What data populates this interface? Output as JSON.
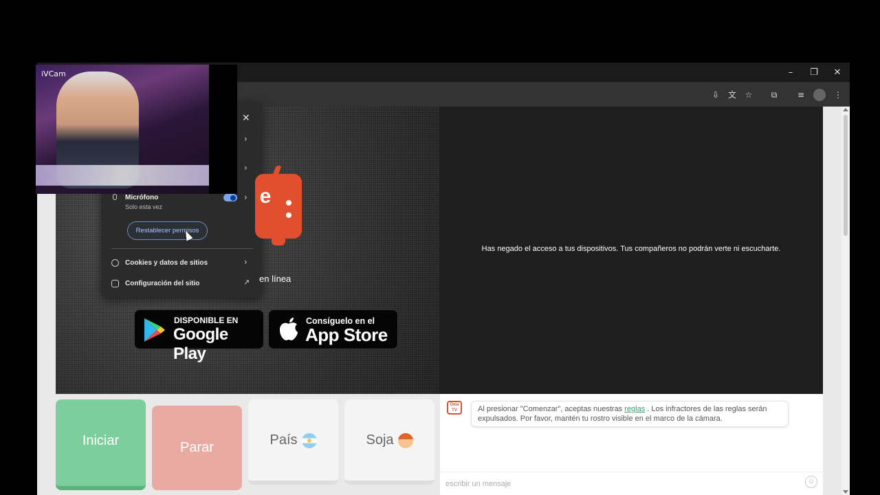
{
  "webcam": {
    "label": "iVCam"
  },
  "window": {
    "minimize": "–",
    "restore": "❐",
    "close": "✕"
  },
  "toolbar": {
    "icons": [
      "install-icon",
      "translate-icon",
      "star-icon",
      "extensions-icon",
      "media-icon",
      "profile-icon",
      "menu-icon"
    ]
  },
  "permissions_popup": {
    "close": "✕",
    "mic_label": "Micrófono",
    "mic_sub": "Solo esta vez",
    "reset_button": "Restablecer permisos",
    "cookies_label": "Cookies y datos de sitios",
    "site_settings_label": "Configuración del sitio"
  },
  "left_panel": {
    "online_text": "en línea",
    "logo_letter": "e",
    "google_badge": {
      "line1": "DISPONIBLE EN",
      "line2": "Google Play"
    },
    "apple_badge": {
      "line1": "Consíguelo en el",
      "line2": "App Store"
    }
  },
  "right_panel": {
    "denied_message": "Has negado el acceso a tus dispositivos. Tus compañeros no podrán verte ni escucharte."
  },
  "controls": {
    "start": "Iniciar",
    "stop": "Parar",
    "country": "País",
    "gender": "Soja"
  },
  "chat": {
    "avatar_text": "Ome TV",
    "message_before": "Al presionar \"Comenzar\", aceptas nuestras ",
    "rules_link": "reglas",
    "message_after": " . Los infractores de las reglas serán expulsados. Por favor, mantén tu rostro visible en el marco de la cámara.",
    "input_placeholder": "escribir un mensaje",
    "emoji": "☺"
  },
  "colors": {
    "start": "#7bcf9a",
    "stop": "#e9aaa1",
    "brand": "#e14f2e",
    "link": "#3aa070"
  }
}
